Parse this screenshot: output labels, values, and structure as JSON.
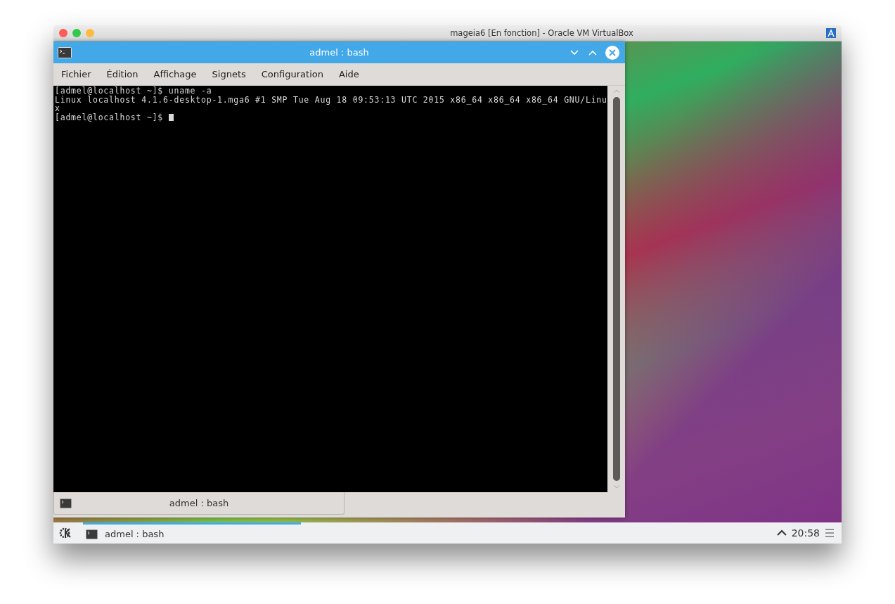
{
  "host_window": {
    "title": "mageia6 [En fonction] - Oracle VM VirtualBox"
  },
  "terminal_window": {
    "title": "admel : bash",
    "menu": [
      "Fichier",
      "Édition",
      "Affichage",
      "Signets",
      "Configuration",
      "Aide"
    ],
    "lines": [
      {
        "kind": "text",
        "text": "[admel@localhost ~]$ uname -a"
      },
      {
        "kind": "text",
        "text": "Linux localhost 4.1.6-desktop-1.mga6 #1 SMP Tue Aug 18 09:53:13 UTC 2015 x86_64 x86_64 x86_64 GNU/Linu"
      },
      {
        "kind": "text",
        "text": "x"
      },
      {
        "kind": "prompt",
        "text": "[admel@localhost ~]$ "
      }
    ],
    "tabs": [
      {
        "label": "admel : bash",
        "selected": true
      }
    ]
  },
  "taskbar": {
    "tasks": [
      {
        "label": "admel : bash",
        "selected": true
      }
    ],
    "clock": "20:58"
  }
}
